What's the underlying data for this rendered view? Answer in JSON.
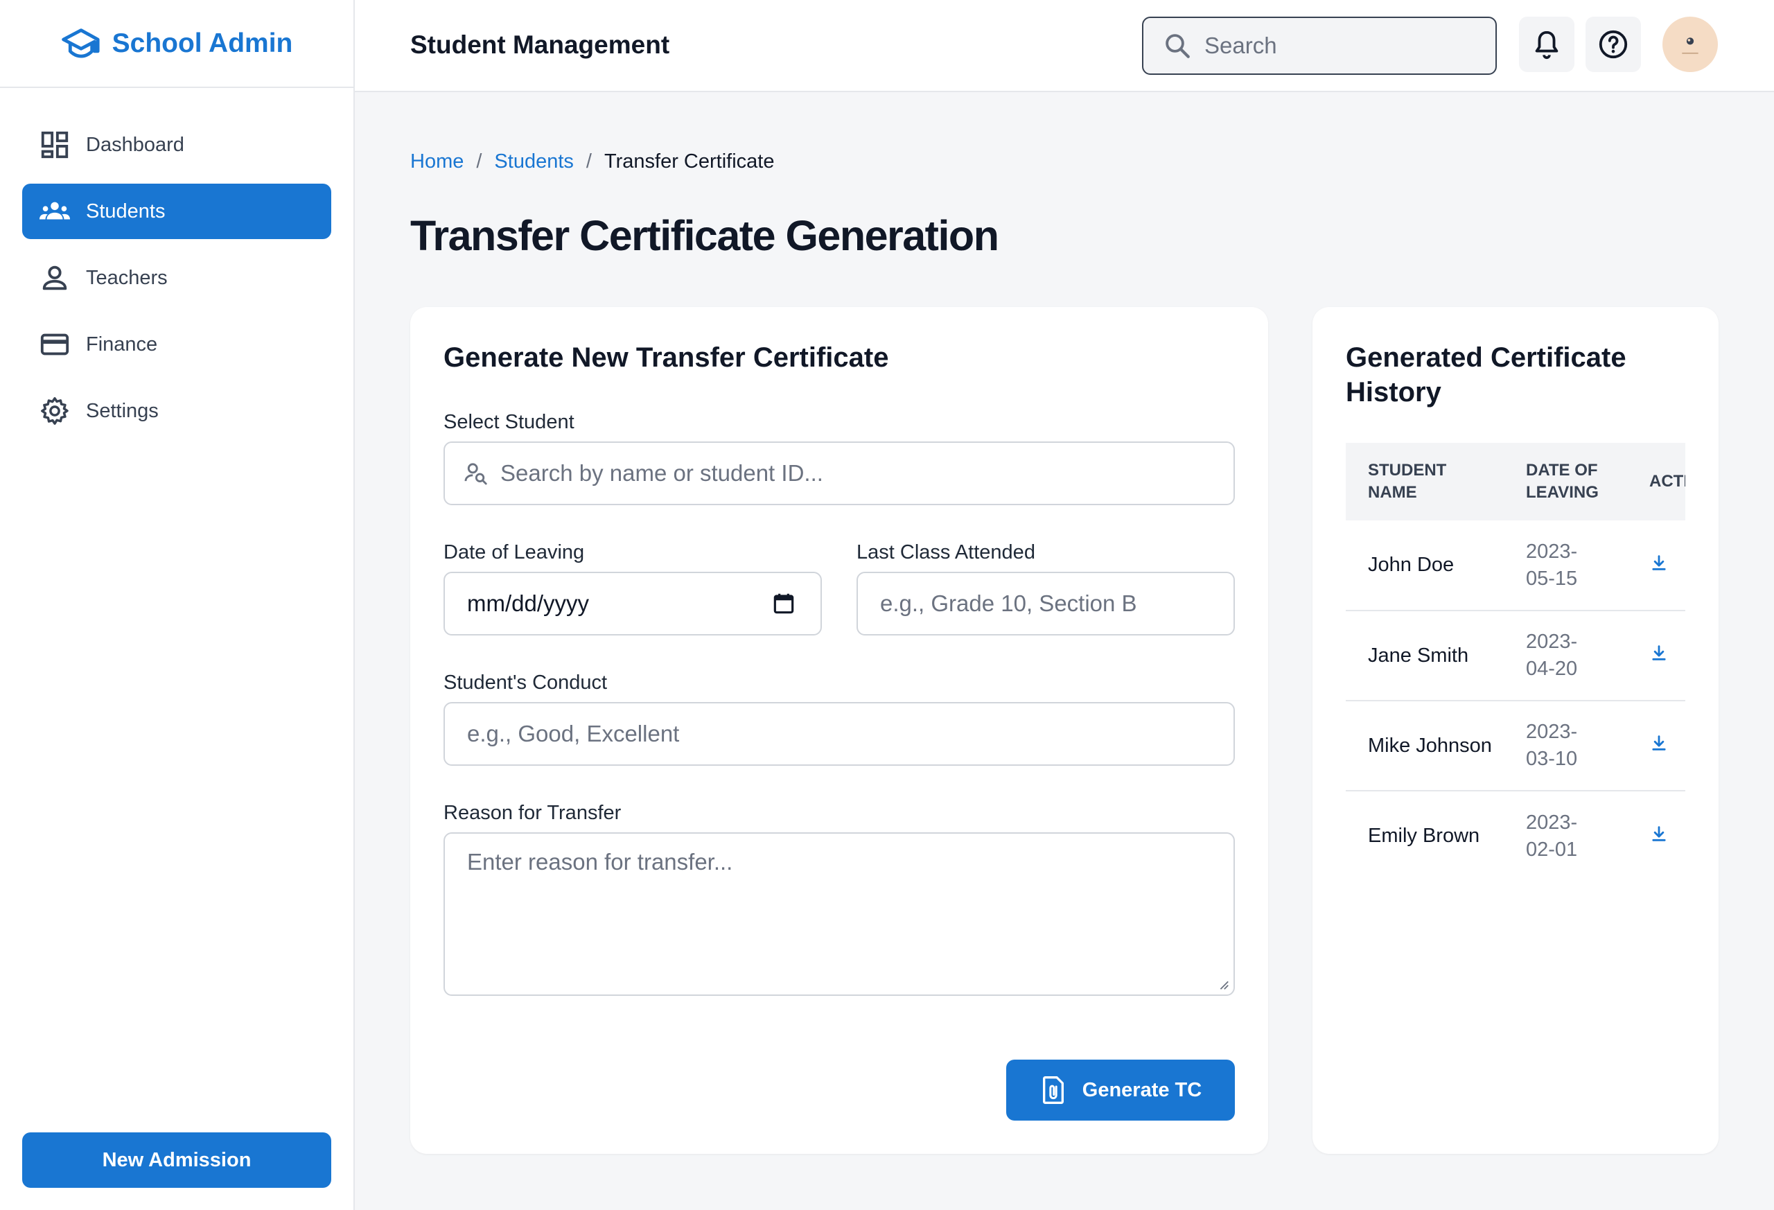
{
  "app": {
    "name": "School Admin"
  },
  "sidebar": {
    "items": [
      {
        "label": "Dashboard",
        "icon": "dashboard-icon",
        "active": false
      },
      {
        "label": "Students",
        "icon": "people-icon",
        "active": true
      },
      {
        "label": "Teachers",
        "icon": "person-icon",
        "active": false
      },
      {
        "label": "Finance",
        "icon": "credit-card-icon",
        "active": false
      },
      {
        "label": "Settings",
        "icon": "gear-icon",
        "active": false
      }
    ],
    "new_admission_label": "New Admission"
  },
  "header": {
    "title": "Student Management",
    "search_placeholder": "Search"
  },
  "breadcrumb": {
    "home": "Home",
    "students": "Students",
    "current": "Transfer Certificate",
    "separator": "/"
  },
  "page": {
    "title": "Transfer Certificate Generation"
  },
  "form": {
    "title": "Generate New Transfer Certificate",
    "select_student_label": "Select Student",
    "select_student_placeholder": "Search by name or student ID...",
    "date_label": "Date of Leaving",
    "date_value": "mm/dd/yyyy",
    "class_label": "Last Class Attended",
    "class_placeholder": "e.g., Grade 10, Section B",
    "conduct_label": "Student's Conduct",
    "conduct_placeholder": "e.g., Good, Excellent",
    "reason_label": "Reason for Transfer",
    "reason_placeholder": "Enter reason for transfer...",
    "submit_label": "Generate TC"
  },
  "history": {
    "title_line1": "Generated Certificate",
    "title_line2": "History",
    "columns": {
      "name_l1": "STUDENT",
      "name_l2": "NAME",
      "date_l1": "DATE OF",
      "date_l2": "LEAVING",
      "action": "ACTIONS"
    },
    "rows": [
      {
        "name": "John Doe",
        "date_l1": "2023-",
        "date_l2": "05-15"
      },
      {
        "name": "Jane Smith",
        "date_l1": "2023-",
        "date_l2": "04-20"
      },
      {
        "name": "Mike Johnson",
        "date_l1": "2023-",
        "date_l2": "03-10"
      },
      {
        "name": "Emily Brown",
        "date_l1": "2023-",
        "date_l2": "02-01"
      }
    ]
  },
  "colors": {
    "accent": "#1976d2",
    "background": "#f5f6f8",
    "border": "#e5e7eb"
  }
}
